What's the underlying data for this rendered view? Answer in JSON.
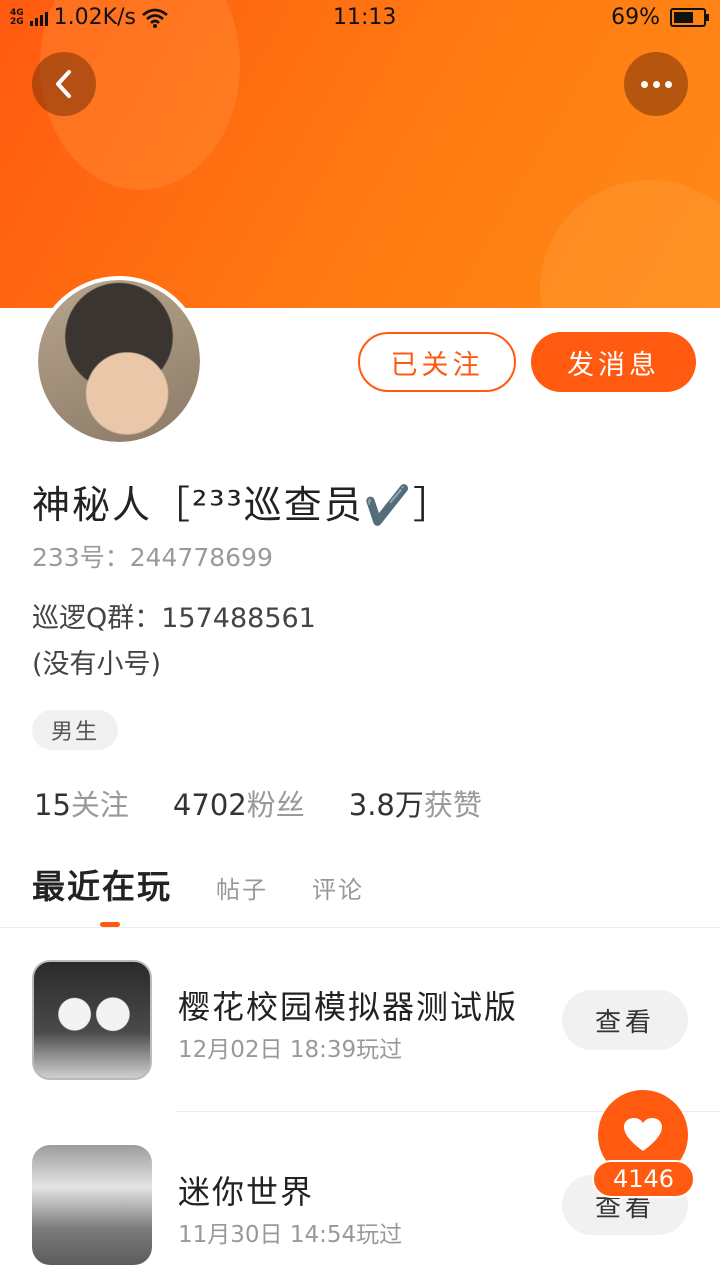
{
  "status_bar": {
    "network_top": "4G",
    "network_bottom": "2G",
    "speed": "1.02K/s",
    "time": "11:13",
    "battery": "69%"
  },
  "colors": {
    "accent": "#ff5a10"
  },
  "icons": {
    "back": "chevron-left-icon",
    "more": "more-horizontal-icon",
    "like": "heart-icon"
  },
  "profile": {
    "name": "神秘人［²³³巡查员✔️］",
    "uid": "233号：244778699",
    "bio": "巡逻Q群：157488561\n(没有小号)",
    "gender": "男生",
    "follow_label": "已关注",
    "message_label": "发消息"
  },
  "stats": [
    {
      "num": "15",
      "label": "关注"
    },
    {
      "num": "4702",
      "label": "粉丝"
    },
    {
      "num": "3.8万",
      "label": "获赞"
    }
  ],
  "tabs": [
    "最近在玩",
    "帖子",
    "评论"
  ],
  "games": [
    {
      "name": "樱花校园模拟器测试版",
      "time": "12月02日  18:39玩过",
      "action": "查看"
    },
    {
      "name": "迷你世界",
      "time": "11月30日  14:54玩过",
      "action": "查看"
    }
  ],
  "like_count": "4146"
}
